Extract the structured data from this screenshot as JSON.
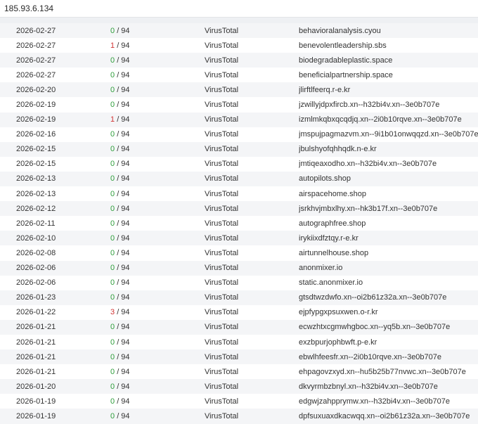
{
  "header": {
    "ip": "185.93.6.134"
  },
  "colors": {
    "clean": "#2e9d3b",
    "flagged": "#d13434"
  },
  "rows": [
    {
      "date": "2026-02-27",
      "positives": "0",
      "total": "/ 94",
      "source": "VirusTotal",
      "domain": "behavioralanalysis.cyou"
    },
    {
      "date": "2026-02-27",
      "positives": "1",
      "total": "/ 94",
      "source": "VirusTotal",
      "domain": "benevolentleadership.sbs"
    },
    {
      "date": "2026-02-27",
      "positives": "0",
      "total": "/ 94",
      "source": "VirusTotal",
      "domain": "biodegradableplastic.space"
    },
    {
      "date": "2026-02-27",
      "positives": "0",
      "total": "/ 94",
      "source": "VirusTotal",
      "domain": "beneficialpartnership.space"
    },
    {
      "date": "2026-02-20",
      "positives": "0",
      "total": "/ 94",
      "source": "VirusTotal",
      "domain": "jlirftlfeerq.r-e.kr"
    },
    {
      "date": "2026-02-19",
      "positives": "0",
      "total": "/ 94",
      "source": "VirusTotal",
      "domain": "jzwillyjdpxfircb.xn--h32bi4v.xn--3e0b707e"
    },
    {
      "date": "2026-02-19",
      "positives": "1",
      "total": "/ 94",
      "source": "VirusTotal",
      "domain": "izmlmkqbxqcqdjq.xn--2i0b10rqve.xn--3e0b707e"
    },
    {
      "date": "2026-02-16",
      "positives": "0",
      "total": "/ 94",
      "source": "VirusTotal",
      "domain": "jmspujpagmazvm.xn--9i1b01onwqqzd.xn--3e0b707e"
    },
    {
      "date": "2026-02-15",
      "positives": "0",
      "total": "/ 94",
      "source": "VirusTotal",
      "domain": "jbulshyofqhhqdk.n-e.kr"
    },
    {
      "date": "2026-02-15",
      "positives": "0",
      "total": "/ 94",
      "source": "VirusTotal",
      "domain": "jmtiqeaxodho.xn--h32bi4v.xn--3e0b707e"
    },
    {
      "date": "2026-02-13",
      "positives": "0",
      "total": "/ 94",
      "source": "VirusTotal",
      "domain": "autopilots.shop"
    },
    {
      "date": "2026-02-13",
      "positives": "0",
      "total": "/ 94",
      "source": "VirusTotal",
      "domain": "airspacehome.shop"
    },
    {
      "date": "2026-02-12",
      "positives": "0",
      "total": "/ 94",
      "source": "VirusTotal",
      "domain": "jsrkhvjmbxlhy.xn--hk3b17f.xn--3e0b707e"
    },
    {
      "date": "2026-02-11",
      "positives": "0",
      "total": "/ 94",
      "source": "VirusTotal",
      "domain": "autographfree.shop"
    },
    {
      "date": "2026-02-10",
      "positives": "0",
      "total": "/ 94",
      "source": "VirusTotal",
      "domain": "irykiixdfztqy.r-e.kr"
    },
    {
      "date": "2026-02-08",
      "positives": "0",
      "total": "/ 94",
      "source": "VirusTotal",
      "domain": "airtunnelhouse.shop"
    },
    {
      "date": "2026-02-06",
      "positives": "0",
      "total": "/ 94",
      "source": "VirusTotal",
      "domain": "anonmixer.io"
    },
    {
      "date": "2026-02-06",
      "positives": "0",
      "total": "/ 94",
      "source": "VirusTotal",
      "domain": "static.anonmixer.io"
    },
    {
      "date": "2026-01-23",
      "positives": "0",
      "total": "/ 94",
      "source": "VirusTotal",
      "domain": "gtsdtwzdwfo.xn--oi2b61z32a.xn--3e0b707e"
    },
    {
      "date": "2026-01-22",
      "positives": "3",
      "total": "/ 94",
      "source": "VirusTotal",
      "domain": "ejpfypgxpsuxwen.o-r.kr"
    },
    {
      "date": "2026-01-21",
      "positives": "0",
      "total": "/ 94",
      "source": "VirusTotal",
      "domain": "ecwzhtxcgmwhgboc.xn--yq5b.xn--3e0b707e"
    },
    {
      "date": "2026-01-21",
      "positives": "0",
      "total": "/ 94",
      "source": "VirusTotal",
      "domain": "exzbpurjophbwft.p-e.kr"
    },
    {
      "date": "2026-01-21",
      "positives": "0",
      "total": "/ 94",
      "source": "VirusTotal",
      "domain": "ebwlhfeesfr.xn--2i0b10rqve.xn--3e0b707e"
    },
    {
      "date": "2026-01-21",
      "positives": "0",
      "total": "/ 94",
      "source": "VirusTotal",
      "domain": "ehpagovzxyd.xn--hu5b25b77nvwc.xn--3e0b707e"
    },
    {
      "date": "2026-01-20",
      "positives": "0",
      "total": "/ 94",
      "source": "VirusTotal",
      "domain": "dkvyrmbzbnyl.xn--h32bi4v.xn--3e0b707e"
    },
    {
      "date": "2026-01-19",
      "positives": "0",
      "total": "/ 94",
      "source": "VirusTotal",
      "domain": "edgwjzahpprymw.xn--h32bi4v.xn--3e0b707e"
    },
    {
      "date": "2026-01-19",
      "positives": "0",
      "total": "/ 94",
      "source": "VirusTotal",
      "domain": "dpfsuxuaxdkacwqq.xn--oi2b61z32a.xn--3e0b707e"
    }
  ]
}
